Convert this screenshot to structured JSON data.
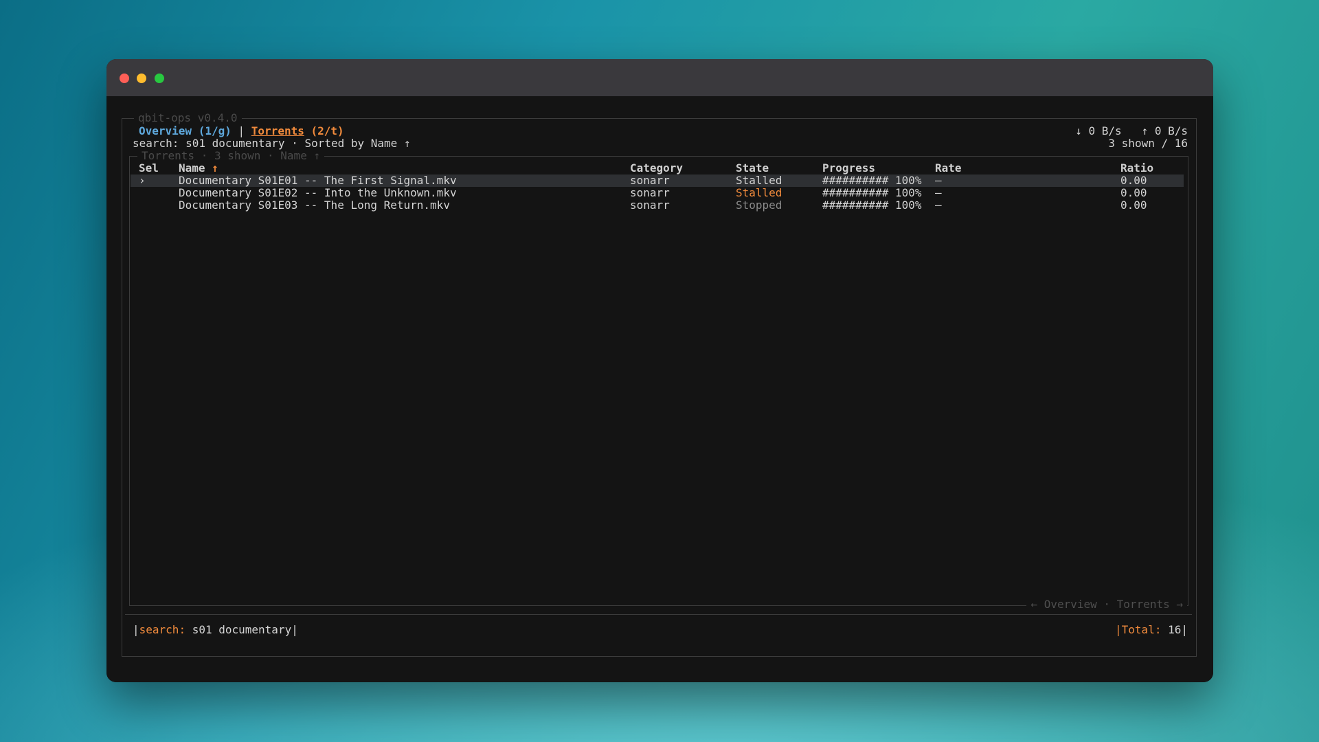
{
  "app": {
    "title": "qbit-ops v0.4.0"
  },
  "tabs": {
    "overview": "Overview (1/g)",
    "separator": "|",
    "torrents_name": "Torrents",
    "torrents_key": " (2/t)"
  },
  "rates": {
    "down": "↓ 0 B/s",
    "up": "↑ 0 B/s"
  },
  "status_line": {
    "left": "search: s01 documentary · Sorted by Name ↑",
    "right": "3 shown / 16"
  },
  "table": {
    "legend": "Torrents · 3 shown · Name ↑",
    "columns": {
      "sel": "Sel",
      "name": "Name",
      "name_sort": "↑",
      "category": "Category",
      "state": "State",
      "progress": "Progress",
      "rate": "Rate",
      "ratio": "Ratio"
    },
    "rows": [
      {
        "sel": "›",
        "name": "Documentary S01E01 -- The First Signal.mkv",
        "category": "sonarr",
        "state": "Stalled",
        "progress": "########## 100%",
        "rate": "—",
        "ratio": "0.00"
      },
      {
        "sel": "",
        "name": "Documentary S01E02 -- Into the Unknown.mkv",
        "category": "sonarr",
        "state": "Stalled",
        "progress": "########## 100%",
        "rate": "—",
        "ratio": "0.00"
      },
      {
        "sel": "",
        "name": "Documentary S01E03 -- The Long Return.mkv",
        "category": "sonarr",
        "state": "Stopped",
        "progress": "########## 100%",
        "rate": "—",
        "ratio": "0.00"
      }
    ],
    "footer_nav": "← Overview · Torrents →"
  },
  "footer": {
    "left_open": "|",
    "search_label": "search:",
    "search_value": " s01 documentary",
    "left_close": "|",
    "right_open": "|",
    "total_label": "Total:",
    "total_value": " 16",
    "right_close": "|"
  },
  "colors": {
    "accent_blue": "#5ea8dc",
    "accent_orange": "#f08a3c",
    "selected_row": "#2e3033",
    "terminal_bg": "#141414"
  }
}
